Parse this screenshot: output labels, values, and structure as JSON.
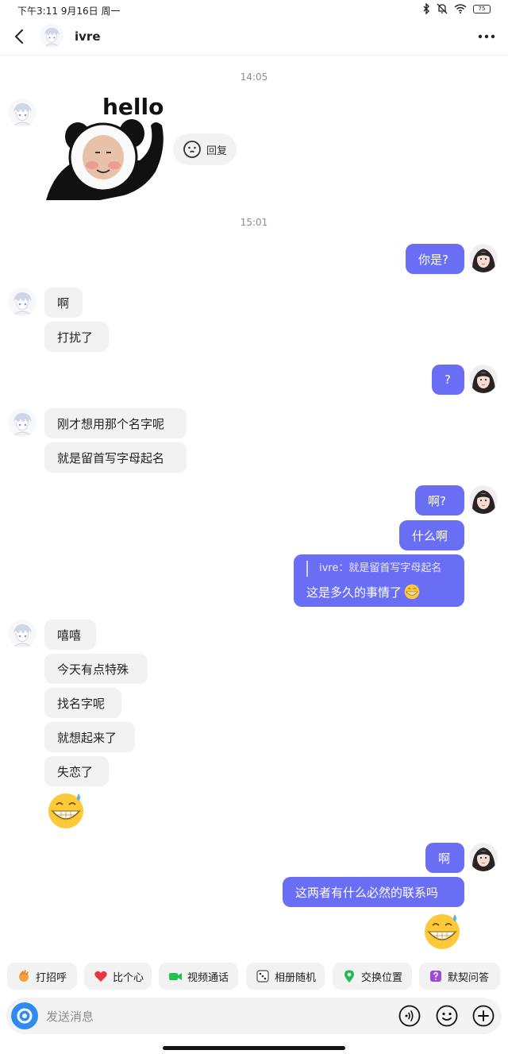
{
  "status_bar": {
    "time": "下午3:11",
    "date": "9月16日 周一",
    "battery": "75"
  },
  "header": {
    "contact_name": "ivre"
  },
  "timestamps": [
    "14:05",
    "15:01"
  ],
  "sticker": {
    "caption": "hello"
  },
  "reply_button": {
    "label": "回复"
  },
  "messages": {
    "m1": "你是?",
    "m2": "啊",
    "m3": "打扰了",
    "m4": "?",
    "m5": "刚才想用那个名字呢",
    "m6": "就是留首写字母起名",
    "m7": "啊?",
    "m8": "什么啊",
    "m9": "嘻嘻",
    "m10": "今天有点特殊",
    "m11": "找名字呢",
    "m12": "就想起来了",
    "m13": "失恋了",
    "m14": "啊",
    "m15": "这两者有什么必然的联系吗"
  },
  "quoted_reply": {
    "quote": "ivre：就是留首写字母起名",
    "text": "这是多久的事情了"
  },
  "quick_actions": [
    "打招呼",
    "比个心",
    "视频通话",
    "相册随机",
    "交换位置",
    "默契问答"
  ],
  "input": {
    "placeholder": "发送消息"
  },
  "colors": {
    "outgoing_bubble": "#6a6ef5",
    "incoming_bubble": "#f2f2f2",
    "accent_blue": "#2e8cf0"
  }
}
